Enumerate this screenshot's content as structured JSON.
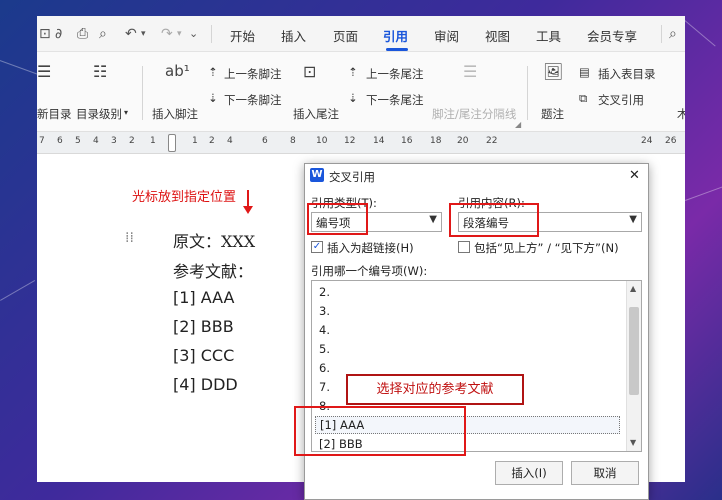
{
  "tabs": {
    "items": [
      "开始",
      "插入",
      "页面",
      "引用",
      "审阅",
      "视图",
      "工具",
      "会员专享"
    ],
    "active": "引用"
  },
  "ribbon": {
    "toc": "新目录",
    "toc_level": "目录级别",
    "insert_footnote": "插入脚注",
    "prev_footnote": "上一条脚注",
    "next_footnote": "下一条脚注",
    "insert_endnote": "插入尾注",
    "prev_endnote": "上一条尾注",
    "next_endnote": "下一条尾注",
    "separator": "脚注/尾注分隔线",
    "caption": "题注",
    "insert_toc_table": "插入表目录",
    "cross_ref": "交叉引用"
  },
  "ruler": {
    "labels": [
      "7",
      "6",
      "5",
      "4",
      "3",
      "2",
      "1",
      "1",
      "2",
      "4",
      "6",
      "8",
      "10",
      "12",
      "14",
      "16",
      "18",
      "20",
      "22",
      "24",
      "26"
    ]
  },
  "document": {
    "line1": "原文：XXX",
    "line2": "参考文献：",
    "refs": [
      "[1]  AAA",
      "[2]  BBB",
      "[3]  CCC",
      "[4]  DDD"
    ]
  },
  "annotations": {
    "cursor_hint": "光标放到指定位置",
    "select_hint": "选择对应的参考文献"
  },
  "dialog": {
    "title": "交叉引用",
    "ref_type_label": "引用类型(T):",
    "ref_type_value": "编号项",
    "ref_content_label": "引用内容(R):",
    "ref_content_value": "段落编号",
    "hyperlink_label": "插入为超链接(H)",
    "hyperlink_checked": "✓",
    "above_below_label": "包括“见上方” / “见下方”(N)",
    "which_label": "引用哪一个编号项(W):",
    "items": [
      "2.",
      "3.",
      "4.",
      "5.",
      "6.",
      "7.",
      "8."
    ],
    "selected_item": "[1] AAA",
    "next_item": "[2] BBB",
    "insert_button": "插入(I)",
    "cancel_button": "取消",
    "close_symbol": "✕"
  },
  "colors": {
    "accent": "#1a56db",
    "highlight": "#e01818"
  }
}
